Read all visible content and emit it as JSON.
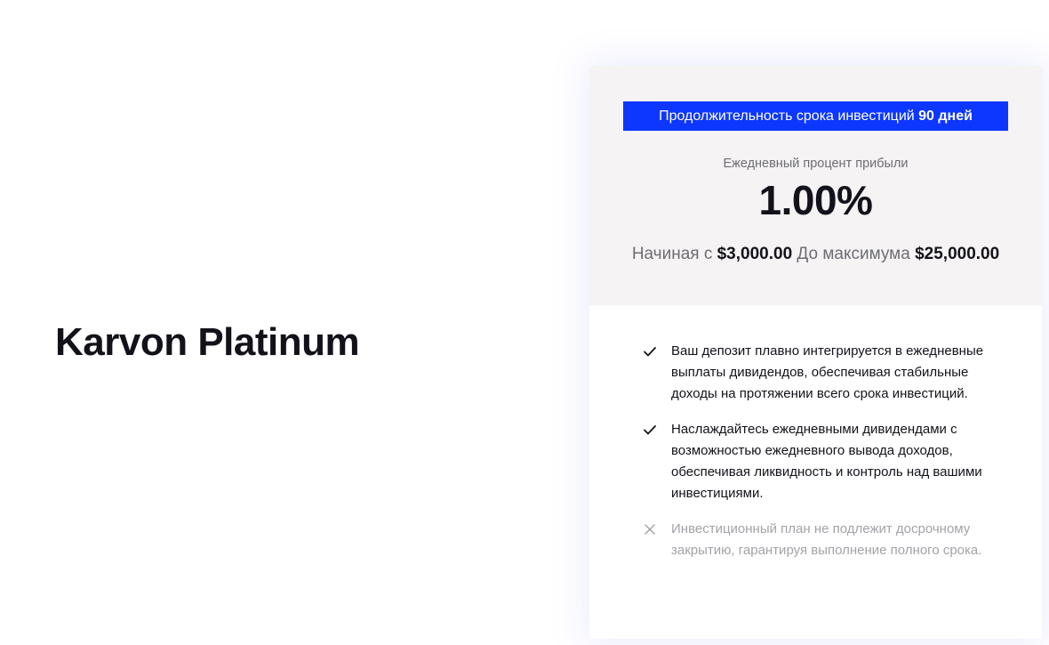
{
  "plan": {
    "title": "Karvon Platinum"
  },
  "card": {
    "duration_label": "Продолжительность срока инвестиций",
    "duration_value": "90 дней",
    "rate_label": "Ежедневный процент прибыли",
    "rate_value": "1.00%",
    "min_label": "Начиная с",
    "min_amount": "$3,000.00",
    "max_label": "До максимума",
    "max_amount": "$25,000.00"
  },
  "features": [
    {
      "icon": "check-icon",
      "enabled": true,
      "text": "Ваш депозит плавно интегрируется в ежедневные выплаты дивидендов, обеспечивая стабильные доходы на протяжении всего срока инвестиций."
    },
    {
      "icon": "check-icon",
      "enabled": true,
      "text": "Наслаждайтесь ежедневными дивидендами с возможностью ежедневного вывода доходов, обеспечивая ликвидность и контроль над вашими инвестициями."
    },
    {
      "icon": "cross-icon",
      "enabled": false,
      "text": "Инвестиционный план не подлежит досрочному закрытию, гарантируя выполнение полного срока."
    }
  ],
  "colors": {
    "accent": "#0d37ff",
    "card_top_bg": "#f5f3f3",
    "text_dark": "#13121a",
    "text_muted": "#6d6c73",
    "text_disabled": "#a3a2a8"
  }
}
